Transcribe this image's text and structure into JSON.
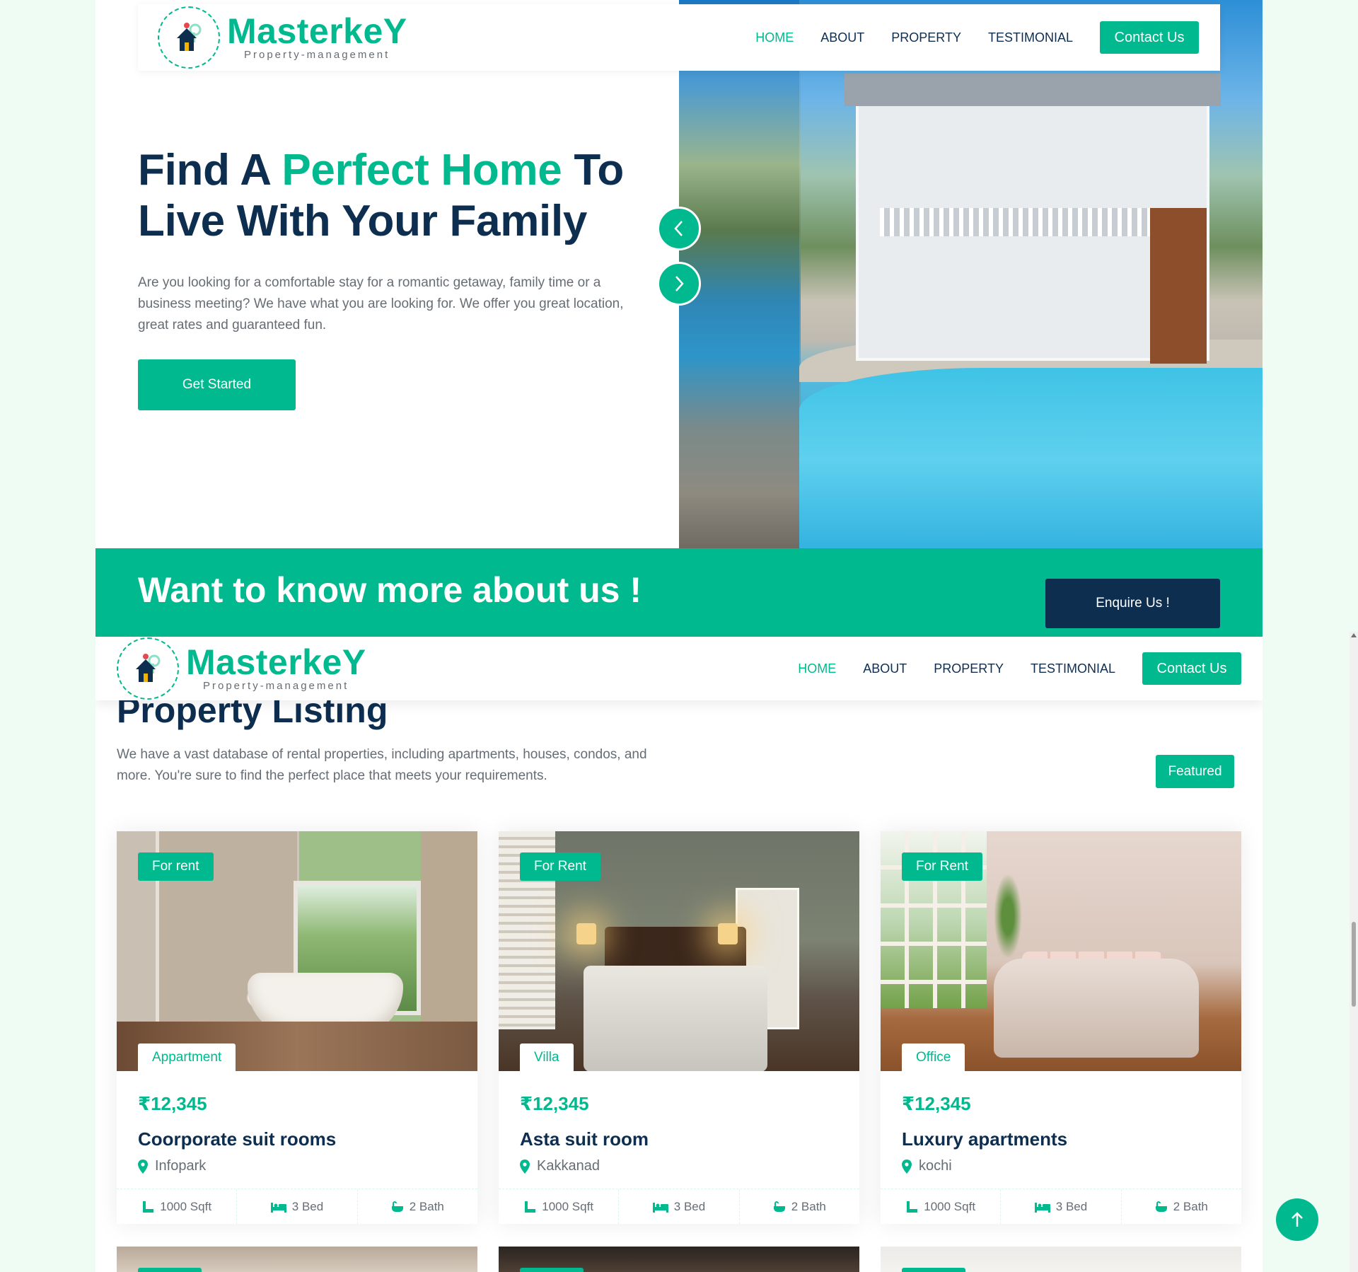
{
  "brand": {
    "name": "MasterkeY",
    "tagline": "Property-management",
    "accent_color": "#00b98e",
    "dark_color": "#0e2e50"
  },
  "nav": {
    "items": [
      {
        "label": "HOME",
        "active": true
      },
      {
        "label": "ABOUT",
        "active": false
      },
      {
        "label": "PROPERTY",
        "active": false
      },
      {
        "label": "TESTIMONIAL",
        "active": false
      }
    ],
    "contact_label": "Contact Us"
  },
  "hero": {
    "title_part1": "Find A ",
    "title_accent": "Perfect Home",
    "title_part2": " To Live With Your Family",
    "description": "Are you looking for a comfortable stay for a romantic getaway, family time or a business meeting? We have what you are looking for. We offer you great location, great rates and guaranteed fun.",
    "cta_label": "Get Started",
    "prev_icon": "chevron-left-icon",
    "next_icon": "chevron-right-icon"
  },
  "cta_band": {
    "title": "Want to know more about us !",
    "button_label": "Enquire Us !"
  },
  "listing": {
    "title": "Property Listing",
    "description": "We have a vast database of rental properties, including apartments, houses, condos, and more. You're sure to find the perfect place that meets your requirements.",
    "filter_label": "Featured",
    "cards": [
      {
        "status": "For rent",
        "type": "Appartment",
        "price": "₹12,345",
        "name": "Coorporate suit rooms",
        "location": "Infopark",
        "area": "1000 Sqft",
        "beds": "3 Bed",
        "baths": "2 Bath"
      },
      {
        "status": "For Rent",
        "type": "Villa",
        "price": "₹12,345",
        "name": "Asta suit room",
        "location": "Kakkanad",
        "area": "1000 Sqft",
        "beds": "3 Bed",
        "baths": "2 Bath"
      },
      {
        "status": "For Rent",
        "type": "Office",
        "price": "₹12,345",
        "name": "Luxury apartments",
        "location": "kochi",
        "area": "1000 Sqft",
        "beds": "3 Bed",
        "baths": "2 Bath"
      }
    ]
  },
  "back_to_top_icon": "arrow-up-icon"
}
